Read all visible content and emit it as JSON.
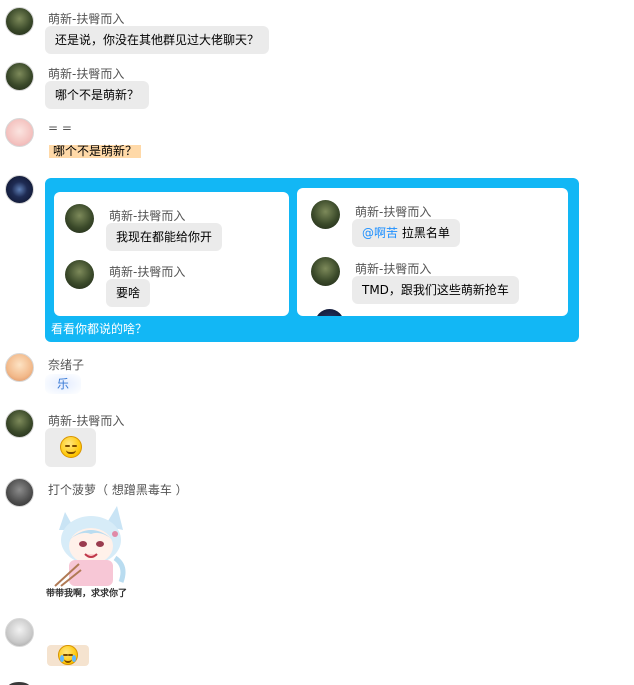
{
  "messages": [
    {
      "name": "萌新-扶臀而入",
      "text": "还是说，你没在其他群见过大佬聊天？"
    },
    {
      "name": "萌新-扶臀而入",
      "text": "哪个不是萌新？"
    },
    {
      "name": "= =",
      "text": "哪个不是萌新？"
    },
    {
      "name": "奈绪子",
      "text": "乐"
    },
    {
      "name": "萌新-扶臀而入",
      "emoji": "grinning-face-emoji"
    },
    {
      "name": "打个菠萝（ 想蹭黑毒车 ）",
      "sticker_caption": "带带我啊，求求你了"
    },
    {
      "name": "",
      "emoji": "tears-of-joy-emoji"
    }
  ],
  "forward": {
    "caption": "看看你都说的啥？",
    "left_card": [
      {
        "name": "萌新-扶臀而入",
        "text": "我现在都能给你开"
      },
      {
        "name": "萌新-扶臀而入",
        "text": "要啥"
      }
    ],
    "right_card": [
      {
        "name": "萌新-扶臀而入",
        "mention": "@啊苦",
        "text": " 拉黑名单"
      },
      {
        "name": "萌新-扶臀而入",
        "text": "TMD，跟我们这些萌新抢车"
      }
    ]
  },
  "colors": {
    "forward_bg": "#12b7f5",
    "bubble_bg": "#ebebeb",
    "highlight_bg": "#ffd9a8",
    "mention": "#1e90ff"
  }
}
